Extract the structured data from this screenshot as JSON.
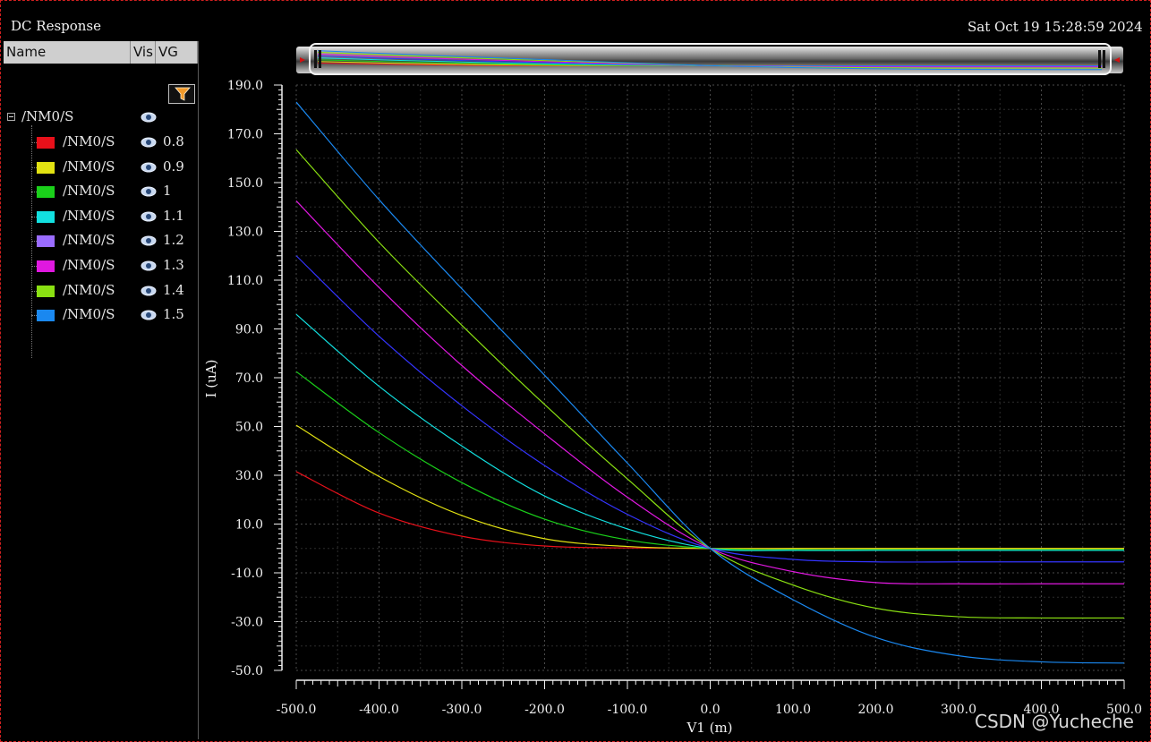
{
  "window": {
    "title": "DC Response",
    "timestamp": "Sat Oct 19 15:28:59 2024"
  },
  "panel": {
    "columns": {
      "name": "Name",
      "vis": "Vis",
      "param": "VG"
    },
    "group": {
      "label": "/NM0/S"
    },
    "items": [
      {
        "label": "/NM0/S",
        "vg": "0.8",
        "color": "#e8101a"
      },
      {
        "label": "/NM0/S",
        "vg": "0.9",
        "color": "#e2e212"
      },
      {
        "label": "/NM0/S",
        "vg": "1",
        "color": "#1ad01a"
      },
      {
        "label": "/NM0/S",
        "vg": "1.1",
        "color": "#12e0e0"
      },
      {
        "label": "/NM0/S",
        "vg": "1.2",
        "color": "#9a6cff"
      },
      {
        "label": "/NM0/S",
        "vg": "1.3",
        "color": "#e018e0"
      },
      {
        "label": "/NM0/S",
        "vg": "1.4",
        "color": "#8ae012"
      },
      {
        "label": "/NM0/S",
        "vg": "1.5",
        "color": "#1a88f0"
      }
    ]
  },
  "chart_data": {
    "type": "line",
    "title": "DC Response",
    "xlabel": "V1 (m)",
    "ylabel": "I (uA)",
    "xlim": [
      -500,
      500
    ],
    "ylim": [
      -50,
      190
    ],
    "xticks": [
      "-500.0",
      "-400.0",
      "-300.0",
      "-200.0",
      "-100.0",
      "0.0",
      "100.0",
      "200.0",
      "300.0",
      "400.0",
      "500.0"
    ],
    "yticks": [
      "190.0",
      "170.0",
      "150.0",
      "130.0",
      "110.0",
      "90.0",
      "70.0",
      "50.0",
      "30.0",
      "10.0",
      "-10.0",
      "-30.0",
      "-50.0"
    ],
    "grid": true,
    "series": [
      {
        "name": "0.8",
        "color": "#e8101a",
        "x": [
          -500,
          -400,
          -300,
          -200,
          -100,
          0,
          100,
          200,
          300,
          400,
          500
        ],
        "y": [
          31.5,
          14.5,
          5,
          1,
          0.2,
          0,
          0,
          0,
          0,
          0,
          0
        ]
      },
      {
        "name": "0.9",
        "color": "#e2e212",
        "x": [
          -500,
          -400,
          -300,
          -200,
          -100,
          0,
          100,
          200,
          300,
          400,
          500
        ],
        "y": [
          50.5,
          29.5,
          13.5,
          4,
          0.8,
          0,
          0,
          0,
          0,
          0,
          0
        ]
      },
      {
        "name": "1",
        "color": "#1ad01a",
        "x": [
          -500,
          -400,
          -300,
          -200,
          -100,
          0,
          100,
          200,
          300,
          400,
          500
        ],
        "y": [
          72.5,
          47.5,
          27,
          12,
          3.5,
          0,
          -0.5,
          -0.5,
          -0.5,
          -0.5,
          -0.5
        ]
      },
      {
        "name": "1.1",
        "color": "#12e0e0",
        "x": [
          -500,
          -400,
          -300,
          -200,
          -100,
          0,
          100,
          200,
          300,
          400,
          500
        ],
        "y": [
          96,
          66.5,
          42,
          21.5,
          8,
          0,
          -0.8,
          -0.8,
          -0.8,
          -0.8,
          -0.8
        ]
      },
      {
        "name": "1.2",
        "color": "#3434ff",
        "x": [
          -500,
          -400,
          -300,
          -200,
          -100,
          0,
          100,
          200,
          300,
          400,
          500
        ],
        "y": [
          120,
          87,
          58.5,
          34,
          14,
          0,
          -4.5,
          -5.5,
          -5.5,
          -5.5,
          -5.5
        ]
      },
      {
        "name": "1.3",
        "color": "#e018e0",
        "x": [
          -500,
          -400,
          -300,
          -200,
          -100,
          0,
          100,
          200,
          300,
          400,
          500
        ],
        "y": [
          142.5,
          107,
          75,
          47,
          21,
          0,
          -9.5,
          -14,
          -14.5,
          -14.5,
          -14.5
        ]
      },
      {
        "name": "1.4",
        "color": "#8ae012",
        "x": [
          -500,
          -400,
          -300,
          -200,
          -100,
          0,
          100,
          200,
          300,
          400,
          500
        ],
        "y": [
          163.5,
          125.5,
          91.5,
          59,
          28.5,
          0,
          -15,
          -24.5,
          -28,
          -28.5,
          -28.5
        ]
      },
      {
        "name": "1.5",
        "color": "#1a88f0",
        "x": [
          -500,
          -400,
          -300,
          -200,
          -100,
          0,
          100,
          200,
          300,
          400,
          500
        ],
        "y": [
          183,
          143,
          106.5,
          71,
          35,
          0,
          -21,
          -36.5,
          -44,
          -46.5,
          -47
        ]
      }
    ]
  },
  "watermark": "CSDN @Yucheche"
}
